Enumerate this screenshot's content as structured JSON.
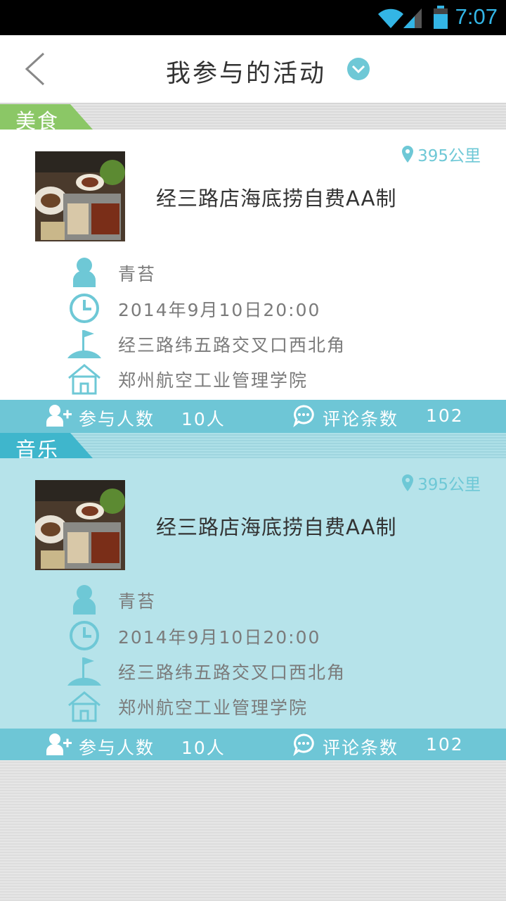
{
  "status_bar": {
    "time": "7:07"
  },
  "header": {
    "title": "我参与的活动"
  },
  "cards": [
    {
      "category": "美食",
      "tag_color": "#8bc766",
      "distance": "395公里",
      "title": "经三路店海底捞自费AA制",
      "organizer": "青苔",
      "time": "2014年9月10日20:00",
      "location": "经三路纬五路交叉口西北角",
      "venue": "郑州航空工业管理学院",
      "participants_label": "参与人数",
      "participants_value": "10人",
      "comments_label": "评论条数",
      "comments_value": "102"
    },
    {
      "category": "音乐",
      "tag_color": "#3fb6cc",
      "distance": "395公里",
      "title": "经三路店海底捞自费AA制",
      "organizer": "青苔",
      "time": "2014年9月10日20:00",
      "location": "经三路纬五路交叉口西北角",
      "venue": "郑州航空工业管理学院",
      "participants_label": "参与人数",
      "participants_value": "10人",
      "comments_label": "评论条数",
      "comments_value": "102"
    }
  ],
  "colors": {
    "accent": "#6ec6d6",
    "icon": "#6ec8d6"
  }
}
